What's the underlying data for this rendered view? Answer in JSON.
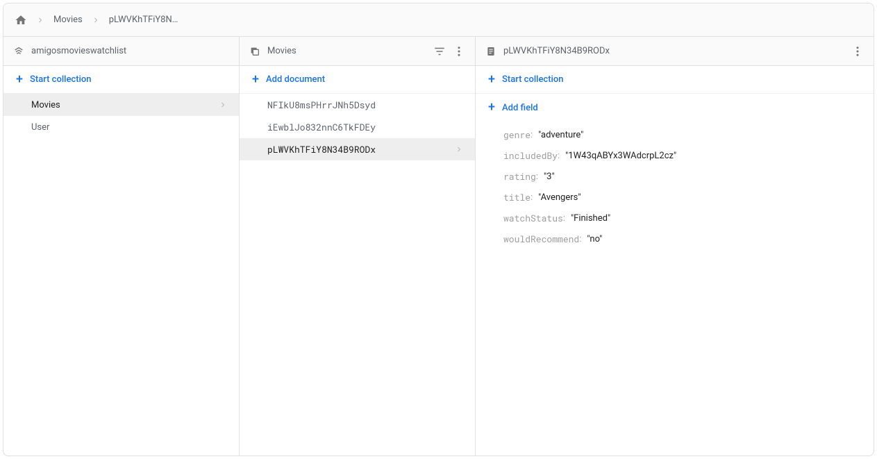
{
  "breadcrumb": {
    "home": "home",
    "items": [
      "Movies",
      "pLWVKhTFiY8N…"
    ]
  },
  "dbPanel": {
    "title": "amigosmovieswatchlist",
    "action": "Start collection",
    "collections": [
      {
        "name": "Movies",
        "selected": true
      },
      {
        "name": "User",
        "selected": false
      }
    ]
  },
  "collPanel": {
    "title": "Movies",
    "action": "Add document",
    "docs": [
      {
        "id": "NFIkU8msPHrrJNh5Dsyd",
        "selected": false
      },
      {
        "id": "iEwblJo832nnC6TkFDEy",
        "selected": false
      },
      {
        "id": "pLWVKhTFiY8N34B9RODx",
        "selected": true
      }
    ]
  },
  "docPanel": {
    "title": "pLWVKhTFiY8N34B9RODx",
    "startCollection": "Start collection",
    "addField": "Add field",
    "fields": [
      {
        "key": "genre",
        "value": "adventure"
      },
      {
        "key": "includedBy",
        "value": "1W43qABYx3WAdcrpL2cz"
      },
      {
        "key": "rating",
        "value": "3"
      },
      {
        "key": "title",
        "value": "Avengers"
      },
      {
        "key": "watchStatus",
        "value": "Finished"
      },
      {
        "key": "wouldRecommend",
        "value": "no"
      }
    ]
  }
}
